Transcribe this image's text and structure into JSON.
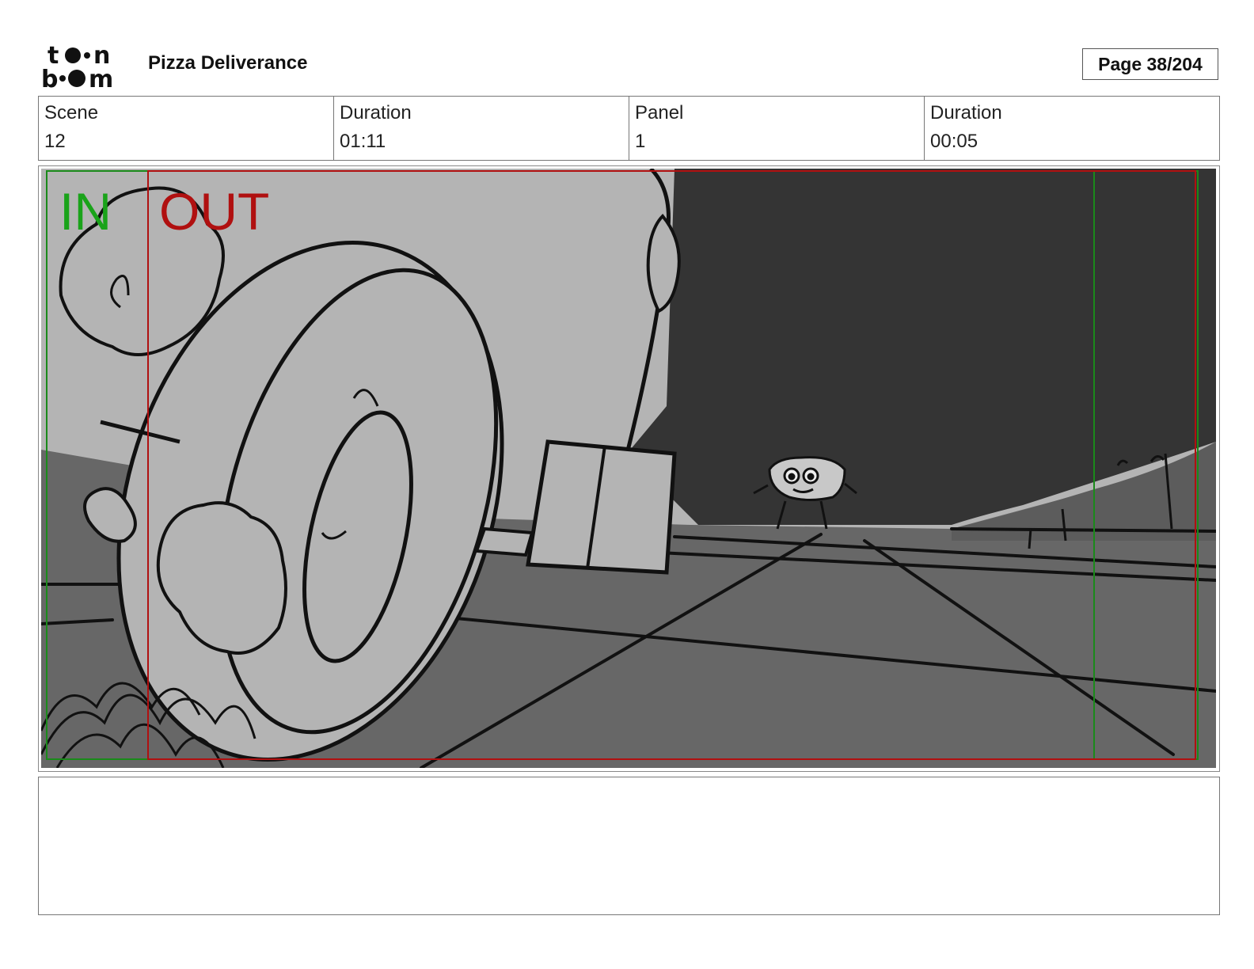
{
  "header": {
    "logo_text": "toon boom",
    "project_title": "Pizza Deliverance",
    "page_label": "Page  38/204"
  },
  "info": [
    {
      "label": "Scene",
      "value": "12"
    },
    {
      "label": "Duration",
      "value": "01:11"
    },
    {
      "label": "Panel",
      "value": "1"
    },
    {
      "label": "Duration",
      "value": "00:05"
    }
  ],
  "panel": {
    "in_marker": "IN",
    "out_marker": "OUT",
    "in_color": "#1aa31a",
    "out_color": "#b01010"
  },
  "notes": {
    "text": ""
  }
}
